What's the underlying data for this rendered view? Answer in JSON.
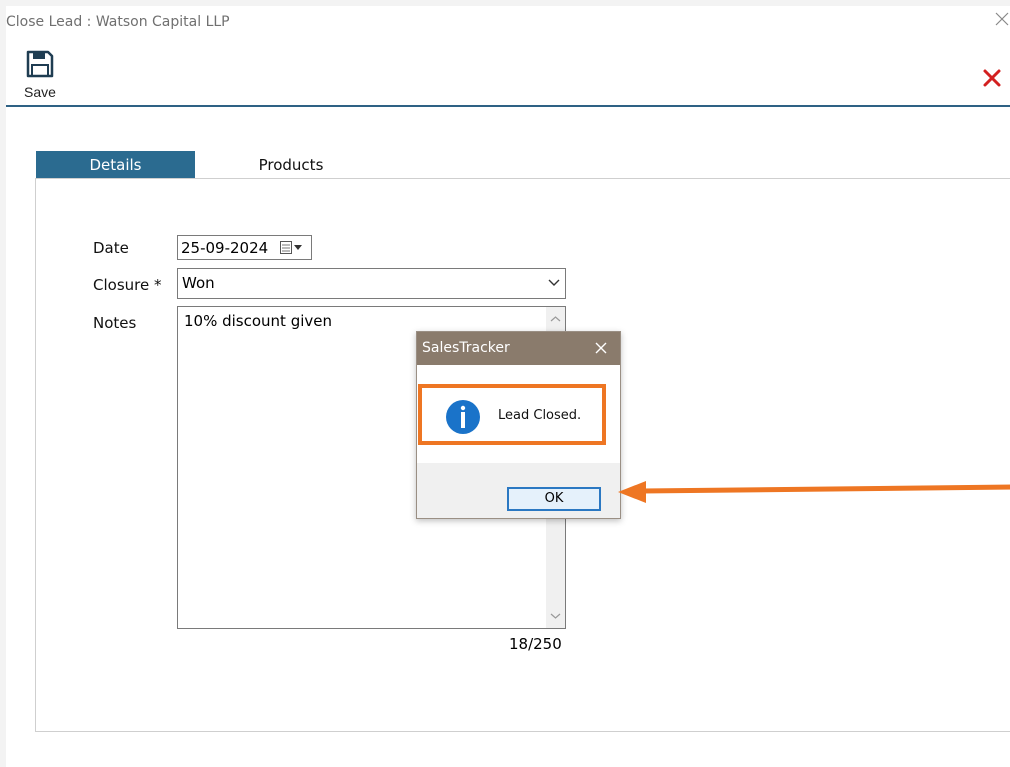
{
  "window": {
    "title": "Close Lead : Watson Capital LLP"
  },
  "toolbar": {
    "save_label": "Save",
    "save_icon": "floppy-disk-icon",
    "close_icon": "red-x-icon",
    "accent": "#2e6184"
  },
  "tabs": [
    {
      "label": "Details",
      "active": true
    },
    {
      "label": "Products",
      "active": false
    }
  ],
  "form": {
    "date_label": "Date",
    "date_value": "25-09-2024",
    "closure_label": "Closure *",
    "closure_value": "Won",
    "notes_label": "Notes",
    "notes_value": "10% discount given",
    "notes_counter": "18/250"
  },
  "dialog": {
    "title": "SalesTracker",
    "message": "Lead Closed.",
    "ok_label": "OK",
    "icon": "info-icon",
    "highlight_color": "#ee7623"
  }
}
